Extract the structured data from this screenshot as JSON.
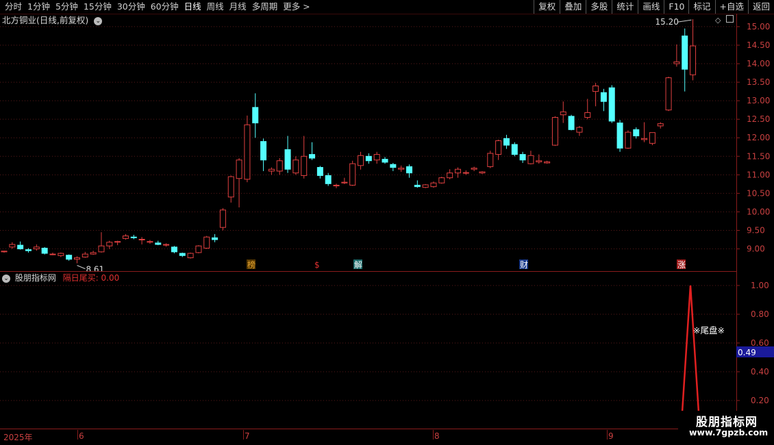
{
  "toolbar": {
    "periods": [
      "分时",
      "1分钟",
      "5分钟",
      "15分钟",
      "30分钟",
      "60分钟",
      "日线",
      "周线",
      "月线",
      "多周期",
      "更多 >"
    ],
    "active_period": "日线",
    "buttons": [
      "复权",
      "叠加",
      "多股",
      "统计",
      "画线",
      "F10",
      "标记",
      "+自选",
      "返回"
    ]
  },
  "stock_title": "北方铜业(日线,前复权)",
  "sub_panel": {
    "name": "股朋指标网",
    "indicator": "隔日尾买: 0.00",
    "marker": "※尾盘※",
    "current_value": "0.49",
    "peak_value": 1.0
  },
  "event_markers": [
    "榜",
    "$",
    "解",
    "财",
    "涨"
  ],
  "date_axis": [
    "2025年",
    "6",
    "7",
    "8",
    "9"
  ],
  "watermark": {
    "name": "股朋指标网",
    "url": "www.7gpzb.com"
  },
  "colors": {
    "up": "#e04040",
    "down": "#54ffff",
    "grid": "#5a1a1a",
    "axis": "#8a1c1c"
  },
  "chart_data": {
    "type": "candlestick",
    "title": "北方铜业(日线,前复权)",
    "y_ticks": [
      "15.00",
      "14.50",
      "14.00",
      "13.50",
      "13.00",
      "12.50",
      "12.00",
      "11.50",
      "11.00",
      "10.50",
      "10.00",
      "9.50",
      "9.00"
    ],
    "ylim": [
      8.4,
      15.35
    ],
    "annotations": {
      "high": "15.20",
      "low": "8.61"
    },
    "candles": [
      [
        8.92,
        8.95,
        8.9,
        8.94
      ],
      [
        9.05,
        9.18,
        9.0,
        9.12
      ],
      [
        9.1,
        9.2,
        8.98,
        9.0
      ],
      [
        8.98,
        9.02,
        8.9,
        8.95
      ],
      [
        9.0,
        9.12,
        8.95,
        9.05
      ],
      [
        9.02,
        9.05,
        8.85,
        8.88
      ],
      [
        8.86,
        8.9,
        8.83,
        8.86
      ],
      [
        8.82,
        8.9,
        8.78,
        8.88
      ],
      [
        8.83,
        8.85,
        8.68,
        8.72
      ],
      [
        8.72,
        8.8,
        8.61,
        8.76
      ],
      [
        8.78,
        8.92,
        8.76,
        8.86
      ],
      [
        8.86,
        8.95,
        8.84,
        8.9
      ],
      [
        8.92,
        9.45,
        8.9,
        9.08
      ],
      [
        9.08,
        9.22,
        9.0,
        9.18
      ],
      [
        9.18,
        9.22,
        9.1,
        9.2
      ],
      [
        9.28,
        9.4,
        9.25,
        9.35
      ],
      [
        9.32,
        9.38,
        9.26,
        9.3
      ],
      [
        9.25,
        9.32,
        9.12,
        9.26
      ],
      [
        9.18,
        9.24,
        9.14,
        9.2
      ],
      [
        9.16,
        9.22,
        9.1,
        9.12
      ],
      [
        9.1,
        9.15,
        9.06,
        9.12
      ],
      [
        9.05,
        9.08,
        8.88,
        8.92
      ],
      [
        8.88,
        8.9,
        8.78,
        8.82
      ],
      [
        8.76,
        8.9,
        8.74,
        8.88
      ],
      [
        8.9,
        9.1,
        8.88,
        9.08
      ],
      [
        9.02,
        9.35,
        9.0,
        9.32
      ],
      [
        9.3,
        9.4,
        9.18,
        9.25
      ],
      [
        9.58,
        10.1,
        9.5,
        10.05
      ],
      [
        10.4,
        10.98,
        10.25,
        10.95
      ],
      [
        10.9,
        11.45,
        10.12,
        11.4
      ],
      [
        10.88,
        12.6,
        10.8,
        12.35
      ],
      [
        12.82,
        13.2,
        12.0,
        12.4
      ],
      [
        11.9,
        11.98,
        11.1,
        11.4
      ],
      [
        11.1,
        11.2,
        11.0,
        11.15
      ],
      [
        11.1,
        11.45,
        11.0,
        11.38
      ],
      [
        11.68,
        12.05,
        11.05,
        11.15
      ],
      [
        11.05,
        11.5,
        11.0,
        11.4
      ],
      [
        10.98,
        12.05,
        10.9,
        11.5
      ],
      [
        11.55,
        11.88,
        11.4,
        11.45
      ],
      [
        11.2,
        11.24,
        10.9,
        10.98
      ],
      [
        10.98,
        11.05,
        10.7,
        10.76
      ],
      [
        10.7,
        10.76,
        10.64,
        10.72
      ],
      [
        10.78,
        10.92,
        10.75,
        10.8
      ],
      [
        10.72,
        11.38,
        10.7,
        11.3
      ],
      [
        11.25,
        11.62,
        11.14,
        11.52
      ],
      [
        11.5,
        11.58,
        11.3,
        11.38
      ],
      [
        11.4,
        11.62,
        11.3,
        11.55
      ],
      [
        11.42,
        11.48,
        11.3,
        11.34
      ],
      [
        11.28,
        11.32,
        11.1,
        11.2
      ],
      [
        11.15,
        11.25,
        11.08,
        11.18
      ],
      [
        11.22,
        11.28,
        10.92,
        11.05
      ],
      [
        10.72,
        10.85,
        10.65,
        10.68
      ],
      [
        10.66,
        10.75,
        10.64,
        10.73
      ],
      [
        10.68,
        10.82,
        10.65,
        10.78
      ],
      [
        10.78,
        10.95,
        10.76,
        10.92
      ],
      [
        10.92,
        11.15,
        10.88,
        11.05
      ],
      [
        11.05,
        11.2,
        10.92,
        11.15
      ],
      [
        11.05,
        11.12,
        11.0,
        11.06
      ],
      [
        11.15,
        11.22,
        11.1,
        11.18
      ],
      [
        11.05,
        11.1,
        11.02,
        11.08
      ],
      [
        11.22,
        11.65,
        11.18,
        11.58
      ],
      [
        11.55,
        11.95,
        11.4,
        11.92
      ],
      [
        11.98,
        12.08,
        11.7,
        11.8
      ],
      [
        11.82,
        11.88,
        11.5,
        11.55
      ],
      [
        11.55,
        11.62,
        11.32,
        11.4
      ],
      [
        11.3,
        11.65,
        11.28,
        11.52
      ],
      [
        11.35,
        11.55,
        11.3,
        11.38
      ],
      [
        11.32,
        11.38,
        11.3,
        11.35
      ],
      [
        11.8,
        12.58,
        11.78,
        12.55
      ],
      [
        12.62,
        12.98,
        12.4,
        12.7
      ],
      [
        12.58,
        12.62,
        12.2,
        12.22
      ],
      [
        12.15,
        12.32,
        12.05,
        12.28
      ],
      [
        12.55,
        13.05,
        12.5,
        12.68
      ],
      [
        13.25,
        13.48,
        12.85,
        13.4
      ],
      [
        13.22,
        13.32,
        12.72,
        12.98
      ],
      [
        13.35,
        13.42,
        12.4,
        12.45
      ],
      [
        12.4,
        12.48,
        11.62,
        11.72
      ],
      [
        11.72,
        12.2,
        11.7,
        12.15
      ],
      [
        12.22,
        12.28,
        11.98,
        12.05
      ],
      [
        11.95,
        12.42,
        11.88,
        11.98
      ],
      [
        11.85,
        12.12,
        11.8,
        12.14
      ],
      [
        12.32,
        12.42,
        12.25,
        12.38
      ],
      [
        12.75,
        13.65,
        12.72,
        13.62
      ],
      [
        14.0,
        14.52,
        13.92,
        14.05
      ],
      [
        14.75,
        14.95,
        13.25,
        13.85
      ],
      [
        13.7,
        15.2,
        13.55,
        14.48
      ]
    ]
  }
}
